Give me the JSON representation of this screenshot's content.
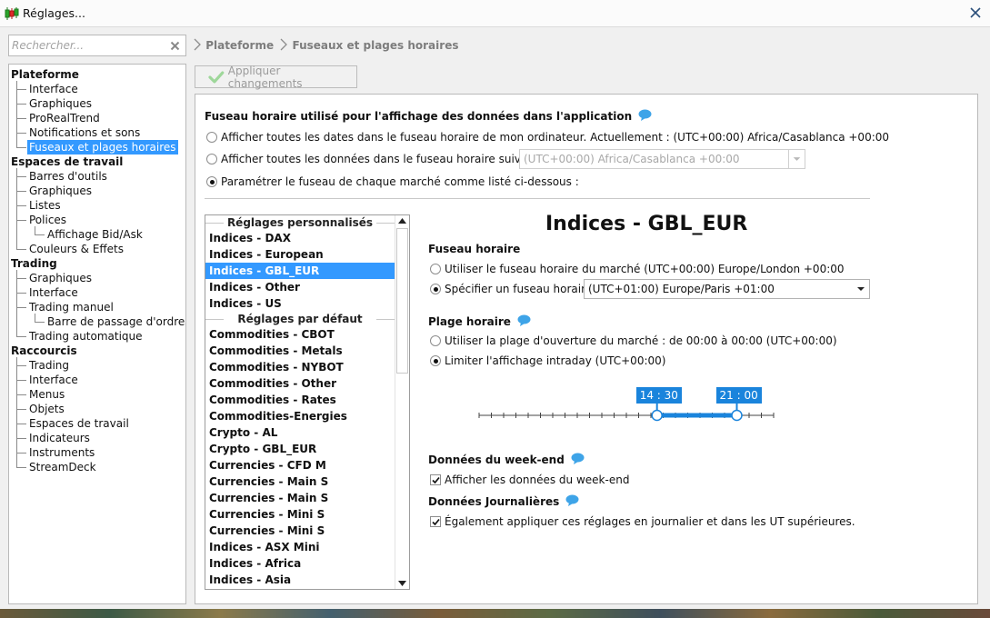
{
  "window": {
    "title": "Réglages..."
  },
  "search": {
    "placeholder": "Rechercher..."
  },
  "tree": [
    {
      "label": "Plateforme",
      "cat": true
    },
    {
      "label": "Interface"
    },
    {
      "label": "Graphiques"
    },
    {
      "label": "ProRealTrend"
    },
    {
      "label": "Notifications et sons"
    },
    {
      "label": "Fuseaux et plages horaires",
      "selected": true
    },
    {
      "label": "Espaces de travail",
      "cat": true
    },
    {
      "label": "Barres d'outils"
    },
    {
      "label": "Graphiques"
    },
    {
      "label": "Listes"
    },
    {
      "label": "Polices"
    },
    {
      "label": "Affichage Bid/Ask",
      "sub": true
    },
    {
      "label": "Couleurs & Effets"
    },
    {
      "label": "Trading",
      "cat": true
    },
    {
      "label": "Graphiques"
    },
    {
      "label": "Interface"
    },
    {
      "label": "Trading manuel"
    },
    {
      "label": "Barre de passage d'ordres",
      "sub": true
    },
    {
      "label": "Trading automatique"
    },
    {
      "label": "Raccourcis",
      "cat": true
    },
    {
      "label": "Trading"
    },
    {
      "label": "Interface"
    },
    {
      "label": "Menus"
    },
    {
      "label": "Objets"
    },
    {
      "label": "Espaces de travail"
    },
    {
      "label": "Indicateurs"
    },
    {
      "label": "Instruments"
    },
    {
      "label": "StreamDeck"
    }
  ],
  "breadcrumb": {
    "level1": "Plateforme",
    "level2": "Fuseaux et plages horaires"
  },
  "toolbar": {
    "apply_label": "Appliquer changements"
  },
  "tz": {
    "heading": "Fuseau horaire utilisé pour l'affichage des données dans l'application",
    "opt1": "Afficher toutes les dates dans le fuseau horaire de mon ordinateur. Actuellement : (UTC+00:00) Africa/Casablanca +00:00",
    "opt2": "Afficher toutes les données dans le fuseau horaire suivant :",
    "opt2_value": "(UTC+00:00) Africa/Casablanca +00:00",
    "opt3": "Paramétrer le fuseau de chaque marché comme listé ci-dessous :"
  },
  "markets": {
    "group_custom": "Réglages personnalisés",
    "custom": [
      "Indices - DAX",
      "Indices - European",
      "Indices - GBL_EUR",
      "Indices - Other",
      "Indices - US"
    ],
    "group_default": "Réglages par défaut",
    "defaults": [
      "Commodities - CBOT",
      "Commodities - Metals",
      "Commodities - NYBOT",
      "Commodities - Other",
      "Commodities - Rates",
      "Commodities-Energies",
      "Crypto - AL",
      "Crypto - GBL_EUR",
      "Currencies - CFD M",
      "Currencies - Main S",
      "Currencies - Main S",
      "Currencies - Mini S",
      "Currencies - Mini S",
      "Indices - ASX Mini",
      "Indices - Africa",
      "Indices - Asia"
    ],
    "selected": "Indices - GBL_EUR"
  },
  "detail": {
    "title": "Indices - GBL_EUR",
    "fuseau_heading": "Fuseau horaire",
    "fuseau_opt1": "Utiliser le fuseau horaire du marché (UTC+00:00) Europe/London +00:00",
    "fuseau_opt2": "Spécifier un fuseau horaire :",
    "fuseau_value": "(UTC+01:00) Europe/Paris +01:00",
    "plage_heading": "Plage horaire",
    "plage_opt1": "Utiliser la plage d'ouverture du marché : de 00:00 à 00:00  (UTC+00:00)",
    "plage_opt2": "Limiter l'affichage intraday (UTC+00:00)",
    "range_start": "14 : 30",
    "range_end": "21 : 00",
    "range_start_fraction": 0.604,
    "range_end_fraction": 0.875,
    "weekend_heading": "Données du week-end",
    "weekend_check": "Afficher les données du week-end",
    "daily_heading": "Données Journalières",
    "daily_check": "Également appliquer ces réglages en journalier et dans les UT supérieures."
  },
  "colors": {
    "accent": "#3399ff",
    "slider": "#1a84dc"
  }
}
